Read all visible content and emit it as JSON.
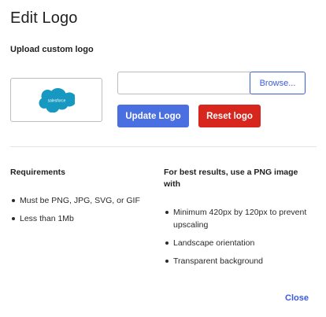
{
  "dialog": {
    "title": "Edit Logo",
    "subtitle": "Upload custom logo"
  },
  "logo_preview": {
    "logo_text": "salesforce",
    "logo_color": "#1798c1"
  },
  "upload": {
    "file_value": "",
    "browse_label": "Browse..."
  },
  "actions": {
    "update_label": "Update Logo",
    "reset_label": "Reset logo",
    "close_label": "Close"
  },
  "requirements": {
    "heading": "Requirements",
    "items": [
      "Must be PNG, JPG, SVG, or GIF",
      "Less than 1Mb"
    ]
  },
  "best_results": {
    "heading": "For best results, use a PNG image with",
    "items": [
      "Minimum 420px by 120px to prevent upscaling",
      "Landscape orientation",
      "Transparent background"
    ]
  },
  "colors": {
    "primary": "#4a6fe0",
    "danger": "#d7261e",
    "link": "#3b5bdb"
  }
}
